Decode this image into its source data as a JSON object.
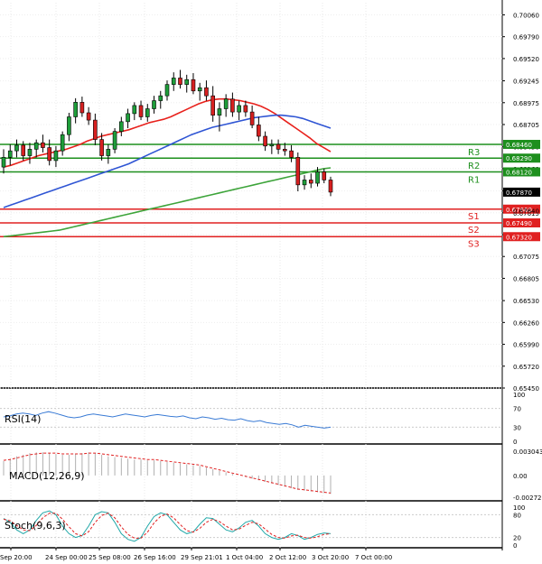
{
  "chart_data": [
    {
      "type": "candlestick",
      "title": "",
      "ylim": [
        0.6545,
        0.7021
      ],
      "y_ticks": [
        "0.70060",
        "0.69790",
        "0.69520",
        "0.69245",
        "0.68975",
        "0.68705",
        "0.68430",
        "0.68160",
        "0.67885",
        "0.67615",
        "0.67345",
        "0.67075",
        "0.66805",
        "0.66530",
        "0.66260",
        "0.65990",
        "0.65720",
        "0.65450"
      ],
      "x_ticks": [
        "Sep 20:00",
        "24 Sep 00:00",
        "25 Sep 08:00",
        "26 Sep 16:00",
        "29 Sep 21:01",
        "1 Oct 04:00",
        "2 Oct 12:00",
        "3 Oct 20:00",
        "7 Oct 00:00"
      ],
      "candles": [
        {
          "o": 0.6818,
          "h": 0.684,
          "l": 0.681,
          "c": 0.683
        },
        {
          "o": 0.683,
          "h": 0.6846,
          "l": 0.682,
          "c": 0.6838
        },
        {
          "o": 0.6838,
          "h": 0.6852,
          "l": 0.683,
          "c": 0.6845
        },
        {
          "o": 0.6845,
          "h": 0.685,
          "l": 0.6826,
          "c": 0.6832
        },
        {
          "o": 0.6832,
          "h": 0.6848,
          "l": 0.6822,
          "c": 0.684
        },
        {
          "o": 0.684,
          "h": 0.6852,
          "l": 0.683,
          "c": 0.6848
        },
        {
          "o": 0.6848,
          "h": 0.6858,
          "l": 0.6836,
          "c": 0.6842
        },
        {
          "o": 0.6842,
          "h": 0.6852,
          "l": 0.682,
          "c": 0.6826
        },
        {
          "o": 0.6826,
          "h": 0.6844,
          "l": 0.6818,
          "c": 0.6838
        },
        {
          "o": 0.6838,
          "h": 0.6862,
          "l": 0.6832,
          "c": 0.6858
        },
        {
          "o": 0.6858,
          "h": 0.6885,
          "l": 0.685,
          "c": 0.688
        },
        {
          "o": 0.688,
          "h": 0.6903,
          "l": 0.6872,
          "c": 0.6898
        },
        {
          "o": 0.6898,
          "h": 0.6905,
          "l": 0.688,
          "c": 0.6885
        },
        {
          "o": 0.6885,
          "h": 0.6892,
          "l": 0.687,
          "c": 0.6876
        },
        {
          "o": 0.6876,
          "h": 0.6884,
          "l": 0.6845,
          "c": 0.6852
        },
        {
          "o": 0.6852,
          "h": 0.686,
          "l": 0.6826,
          "c": 0.6832
        },
        {
          "o": 0.6832,
          "h": 0.6846,
          "l": 0.6822,
          "c": 0.684
        },
        {
          "o": 0.684,
          "h": 0.6866,
          "l": 0.6835,
          "c": 0.6862
        },
        {
          "o": 0.6862,
          "h": 0.688,
          "l": 0.6856,
          "c": 0.6874
        },
        {
          "o": 0.6874,
          "h": 0.689,
          "l": 0.6866,
          "c": 0.6884
        },
        {
          "o": 0.6884,
          "h": 0.6898,
          "l": 0.6876,
          "c": 0.6894
        },
        {
          "o": 0.6894,
          "h": 0.69,
          "l": 0.6876,
          "c": 0.688
        },
        {
          "o": 0.688,
          "h": 0.6896,
          "l": 0.6874,
          "c": 0.689
        },
        {
          "o": 0.689,
          "h": 0.6906,
          "l": 0.6884,
          "c": 0.69
        },
        {
          "o": 0.69,
          "h": 0.6912,
          "l": 0.689,
          "c": 0.6906
        },
        {
          "o": 0.6906,
          "h": 0.6925,
          "l": 0.69,
          "c": 0.692
        },
        {
          "o": 0.692,
          "h": 0.6935,
          "l": 0.6912,
          "c": 0.6928
        },
        {
          "o": 0.6928,
          "h": 0.6938,
          "l": 0.6915,
          "c": 0.692
        },
        {
          "o": 0.692,
          "h": 0.6932,
          "l": 0.691,
          "c": 0.6926
        },
        {
          "o": 0.6926,
          "h": 0.6934,
          "l": 0.6908,
          "c": 0.6912
        },
        {
          "o": 0.6912,
          "h": 0.6922,
          "l": 0.69,
          "c": 0.6916
        },
        {
          "o": 0.6916,
          "h": 0.6925,
          "l": 0.69,
          "c": 0.6906
        },
        {
          "o": 0.6906,
          "h": 0.6918,
          "l": 0.6874,
          "c": 0.6882
        },
        {
          "o": 0.6882,
          "h": 0.6898,
          "l": 0.6862,
          "c": 0.689
        },
        {
          "o": 0.689,
          "h": 0.6908,
          "l": 0.688,
          "c": 0.6902
        },
        {
          "o": 0.6902,
          "h": 0.691,
          "l": 0.688,
          "c": 0.6886
        },
        {
          "o": 0.6886,
          "h": 0.69,
          "l": 0.6876,
          "c": 0.6894
        },
        {
          "o": 0.6894,
          "h": 0.69,
          "l": 0.688,
          "c": 0.6886
        },
        {
          "o": 0.6886,
          "h": 0.6894,
          "l": 0.6866,
          "c": 0.687
        },
        {
          "o": 0.687,
          "h": 0.688,
          "l": 0.685,
          "c": 0.6856
        },
        {
          "o": 0.6856,
          "h": 0.6862,
          "l": 0.6838,
          "c": 0.6844
        },
        {
          "o": 0.6844,
          "h": 0.6852,
          "l": 0.6834,
          "c": 0.6846
        },
        {
          "o": 0.6846,
          "h": 0.6852,
          "l": 0.6834,
          "c": 0.684
        },
        {
          "o": 0.684,
          "h": 0.6848,
          "l": 0.6832,
          "c": 0.6838
        },
        {
          "o": 0.6838,
          "h": 0.6845,
          "l": 0.6824,
          "c": 0.683
        },
        {
          "o": 0.683,
          "h": 0.6836,
          "l": 0.6788,
          "c": 0.6796
        },
        {
          "o": 0.6796,
          "h": 0.6808,
          "l": 0.679,
          "c": 0.6802
        },
        {
          "o": 0.6802,
          "h": 0.681,
          "l": 0.6792,
          "c": 0.6798
        },
        {
          "o": 0.6798,
          "h": 0.6818,
          "l": 0.6794,
          "c": 0.6812
        },
        {
          "o": 0.6812,
          "h": 0.6816,
          "l": 0.6798,
          "c": 0.6802
        },
        {
          "o": 0.6802,
          "h": 0.6806,
          "l": 0.6782,
          "c": 0.6787
        }
      ],
      "series": [
        {
          "name": "",
          "color": "#e8211c",
          "values": [
            0.6818,
            0.682,
            0.6823,
            0.6826,
            0.6829,
            0.6832,
            0.6834,
            0.6836,
            0.6838,
            0.684,
            0.6843,
            0.6846,
            0.685,
            0.6853,
            0.6856,
            0.6858,
            0.686,
            0.6862,
            0.6864,
            0.6867,
            0.687,
            0.6873,
            0.6875,
            0.6877,
            0.688,
            0.6884,
            0.6888,
            0.6892,
            0.6896,
            0.6899,
            0.6901,
            0.6902,
            0.6902,
            0.6901,
            0.69,
            0.6898,
            0.6896,
            0.6893,
            0.6889,
            0.6884,
            0.6878,
            0.6872,
            0.6866,
            0.686,
            0.6854,
            0.6847,
            0.6842,
            0.6837
          ]
        },
        {
          "name": "",
          "color": "#2f55d4",
          "values": [
            0.6768,
            0.6771,
            0.6774,
            0.6777,
            0.678,
            0.6783,
            0.6786,
            0.6789,
            0.6792,
            0.6795,
            0.6798,
            0.6801,
            0.6804,
            0.6807,
            0.681,
            0.6813,
            0.6816,
            0.6819,
            0.6822,
            0.6826,
            0.683,
            0.6834,
            0.6838,
            0.6842,
            0.6846,
            0.685,
            0.6854,
            0.6858,
            0.6861,
            0.6864,
            0.6867,
            0.6869,
            0.6871,
            0.6873,
            0.6875,
            0.6877,
            0.6879,
            0.688,
            0.6881,
            0.6882,
            0.6882,
            0.6881,
            0.688,
            0.6878,
            0.6875,
            0.6872,
            0.6869,
            0.6866
          ]
        },
        {
          "name": "",
          "color": "#3da43a",
          "values": [
            0.6732,
            0.6733,
            0.6734,
            0.6735,
            0.6736,
            0.6737,
            0.6738,
            0.6739,
            0.674,
            0.6742,
            0.6744,
            0.6746,
            0.6748,
            0.675,
            0.6752,
            0.6754,
            0.6756,
            0.6758,
            0.676,
            0.6762,
            0.6764,
            0.6766,
            0.6768,
            0.677,
            0.6772,
            0.6774,
            0.6776,
            0.6778,
            0.678,
            0.6782,
            0.6784,
            0.6786,
            0.6788,
            0.679,
            0.6792,
            0.6794,
            0.6796,
            0.6798,
            0.68,
            0.6802,
            0.6804,
            0.6806,
            0.6808,
            0.681,
            0.6812,
            0.6814,
            0.6816,
            0.6817
          ]
        }
      ],
      "levels": [
        {
          "name": "R3",
          "value": 0.6846,
          "label": "0.68460",
          "color": "#1d8f1d"
        },
        {
          "name": "R2",
          "value": 0.6829,
          "label": "0.68290",
          "color": "#1d8f1d"
        },
        {
          "name": "R1",
          "value": 0.6812,
          "label": "0.68120",
          "color": "#1d8f1d"
        },
        {
          "name": "S1",
          "value": 0.6766,
          "label": "0.67660",
          "color": "#e02020"
        },
        {
          "name": "S2",
          "value": 0.6749,
          "label": "0.67490",
          "color": "#e02020"
        },
        {
          "name": "S3",
          "value": 0.6732,
          "label": "0.67320",
          "color": "#e02020"
        }
      ],
      "current_price": "0.67870",
      "hidden_tick": "0.67640"
    },
    {
      "type": "line",
      "name": "RSI(14)",
      "ylim": [
        0,
        100
      ],
      "y_ticks": [
        "100",
        "70",
        "30",
        "0"
      ],
      "color": "#3a7bd5",
      "values": [
        52,
        54,
        58,
        60,
        58,
        55,
        60,
        63,
        60,
        56,
        52,
        50,
        52,
        56,
        58,
        56,
        54,
        52,
        55,
        58,
        56,
        54,
        52,
        55,
        57,
        55,
        53,
        52,
        54,
        50,
        48,
        52,
        50,
        47,
        49,
        46,
        45,
        48,
        44,
        42,
        44,
        40,
        38,
        36,
        38,
        35,
        30,
        34,
        32,
        30,
        28,
        30
      ]
    },
    {
      "type": "histogram",
      "name": "MACD(12,26,9)",
      "ylim": [
        -0.002723,
        0.003043
      ],
      "y_ticks": [
        "0.003043",
        "0.00",
        "-0.002723"
      ],
      "bar_color": "#b0b0b0",
      "signal_color": "#e02020",
      "values": [
        0.0018,
        0.0021,
        0.0024,
        0.0026,
        0.0028,
        0.0029,
        0.0029,
        0.0028,
        0.0027,
        0.0026,
        0.0026,
        0.0027,
        0.0028,
        0.0029,
        0.0028,
        0.0026,
        0.0024,
        0.0023,
        0.0022,
        0.0021,
        0.002,
        0.002,
        0.0019,
        0.0019,
        0.0018,
        0.0017,
        0.0016,
        0.0015,
        0.0014,
        0.0013,
        0.0012,
        0.001,
        0.0008,
        0.0006,
        0.0004,
        0.0002,
        0.0,
        -0.0002,
        -0.0004,
        -0.0006,
        -0.0008,
        -0.001,
        -0.0012,
        -0.0014,
        -0.0016,
        -0.0018,
        -0.0019,
        -0.002,
        -0.0021,
        -0.0022,
        -0.0023
      ],
      "signal": [
        0.0019,
        0.002,
        0.0022,
        0.0024,
        0.0026,
        0.0027,
        0.0028,
        0.0028,
        0.0028,
        0.0027,
        0.0027,
        0.0027,
        0.0027,
        0.0028,
        0.0028,
        0.0027,
        0.0026,
        0.0025,
        0.0024,
        0.0023,
        0.0022,
        0.0021,
        0.002,
        0.002,
        0.0019,
        0.0018,
        0.0017,
        0.0016,
        0.0015,
        0.0014,
        0.0013,
        0.0011,
        0.0009,
        0.0007,
        0.0005,
        0.0003,
        0.0001,
        -0.0001,
        -0.0003,
        -0.0005,
        -0.0007,
        -0.0009,
        -0.0011,
        -0.0013,
        -0.0015,
        -0.0017,
        -0.0018,
        -0.0019,
        -0.002,
        -0.0021,
        -0.0022
      ]
    },
    {
      "type": "line",
      "name": "Stoch(9,6,3)",
      "ylim": [
        0,
        100
      ],
      "y_ticks": [
        "100",
        "80",
        "20",
        "0"
      ],
      "series": [
        {
          "name": "%K",
          "color": "#20a8a8",
          "values": [
            70,
            60,
            40,
            30,
            40,
            65,
            85,
            90,
            80,
            50,
            30,
            20,
            25,
            50,
            80,
            88,
            85,
            60,
            30,
            15,
            10,
            20,
            50,
            75,
            85,
            80,
            60,
            40,
            30,
            35,
            55,
            72,
            70,
            55,
            40,
            35,
            45,
            60,
            65,
            50,
            30,
            20,
            15,
            20,
            30,
            25,
            15,
            20,
            28,
            32,
            30
          ]
        },
        {
          "name": "%D",
          "color": "#e02020",
          "values": [
            68,
            64,
            52,
            40,
            38,
            52,
            72,
            84,
            84,
            68,
            48,
            30,
            24,
            35,
            60,
            78,
            84,
            72,
            48,
            28,
            18,
            18,
            34,
            58,
            76,
            82,
            72,
            54,
            38,
            34,
            44,
            60,
            68,
            62,
            50,
            40,
            42,
            52,
            60,
            56,
            42,
            28,
            20,
            18,
            24,
            26,
            20,
            18,
            22,
            28,
            30
          ]
        }
      ]
    }
  ]
}
